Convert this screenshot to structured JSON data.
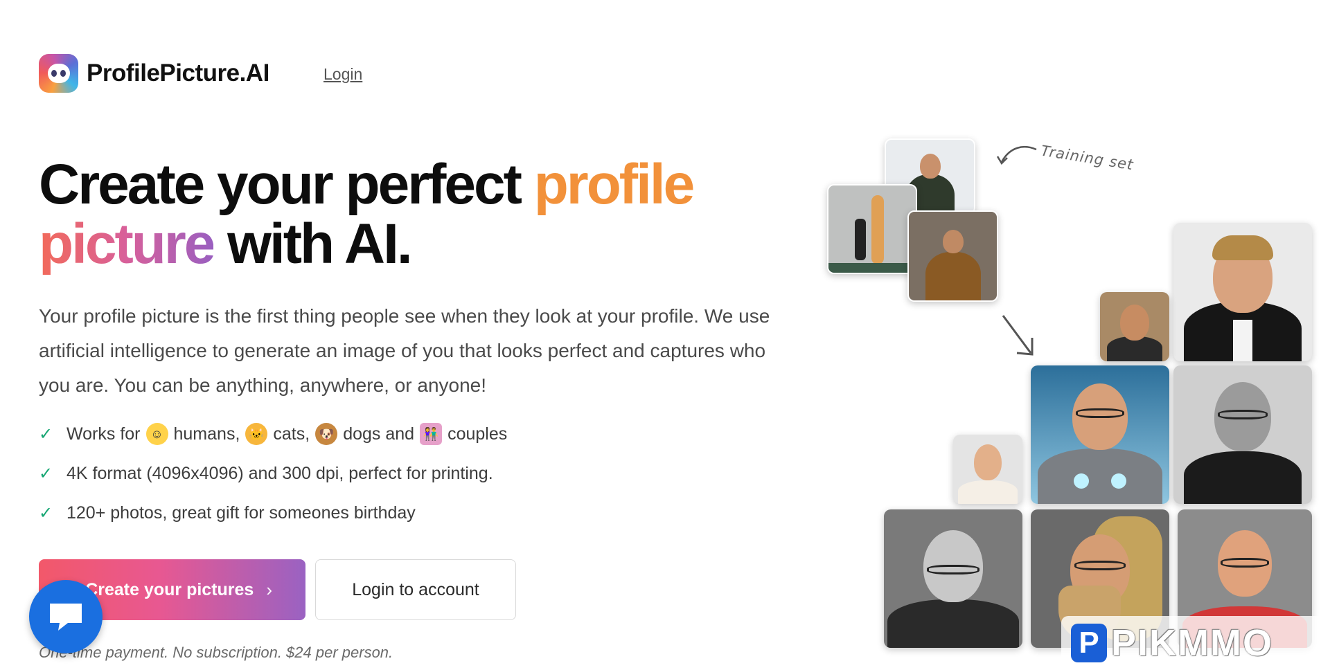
{
  "brand": {
    "name": "ProfilePicture.AI"
  },
  "nav": {
    "login_label": "Login"
  },
  "hero": {
    "headline_part1": "Create your perfect ",
    "headline_highlight1": "profile",
    "headline_highlight2": "picture",
    "headline_part2": " with AI.",
    "intro": "Your profile picture is the first thing people see when they look at your profile. We use artificial intelligence to generate an image of you that looks perfect and captures who you are. You can be anything, anywhere, or anyone!"
  },
  "features": {
    "f1": {
      "prefix": "Works for",
      "humans": "humans,",
      "cats": "cats,",
      "dogs": "dogs and",
      "couples": "couples"
    },
    "f2": "4K format (4096x4096) and 300 dpi, perfect for printing.",
    "f3": "120+ photos, great gift for someones birthday"
  },
  "buttons": {
    "primary_label": "Create your pictures",
    "primary_chevron": "›",
    "secondary_label": "Login to account"
  },
  "footnote": "One-time payment. No subscription. $24 per person.",
  "gallery": {
    "annotation": "Training set"
  },
  "watermark": {
    "letter": "P",
    "text": "PIKMMO"
  },
  "icons": {
    "check": "check-icon",
    "chat": "chat-icon",
    "logo": "robot-logo-icon"
  },
  "colors": {
    "accent_orange": "#f2913a",
    "gradient_start": "#f2586a",
    "gradient_end": "#9a62c2",
    "check_green": "#17a673",
    "chat_blue": "#1a6fe0"
  }
}
